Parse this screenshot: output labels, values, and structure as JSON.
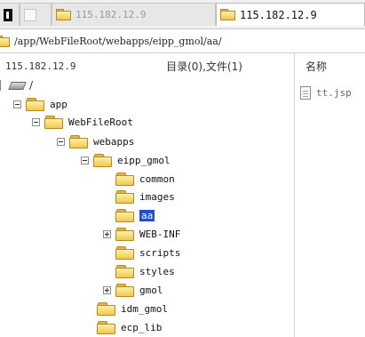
{
  "tabs": [
    {
      "label": ""
    },
    {
      "label": ""
    },
    {
      "label": "115.182.12.9"
    },
    {
      "label": "115.182.12.9"
    }
  ],
  "path": "/app/WebFileRoot/webapps/eipp_gmol/aa/",
  "header": {
    "host": "115.182.12.9",
    "summary": "目录(0),文件(1)",
    "name_col": "名称"
  },
  "tree": {
    "root": "/",
    "items": [
      {
        "label": "app"
      },
      {
        "label": "WebFileRoot"
      },
      {
        "label": "webapps"
      },
      {
        "label": "eipp_gmol"
      },
      {
        "label": "common"
      },
      {
        "label": "images"
      },
      {
        "label": "aa"
      },
      {
        "label": "WEB-INF"
      },
      {
        "label": "scripts"
      },
      {
        "label": "styles"
      },
      {
        "label": "gmol"
      },
      {
        "label": "idm_gmol"
      },
      {
        "label": "ecp_lib"
      }
    ]
  },
  "files": [
    {
      "label": "tt.jsp"
    }
  ],
  "colors": {
    "selection": "#1f4fd2",
    "folder": "#f0c94d"
  }
}
